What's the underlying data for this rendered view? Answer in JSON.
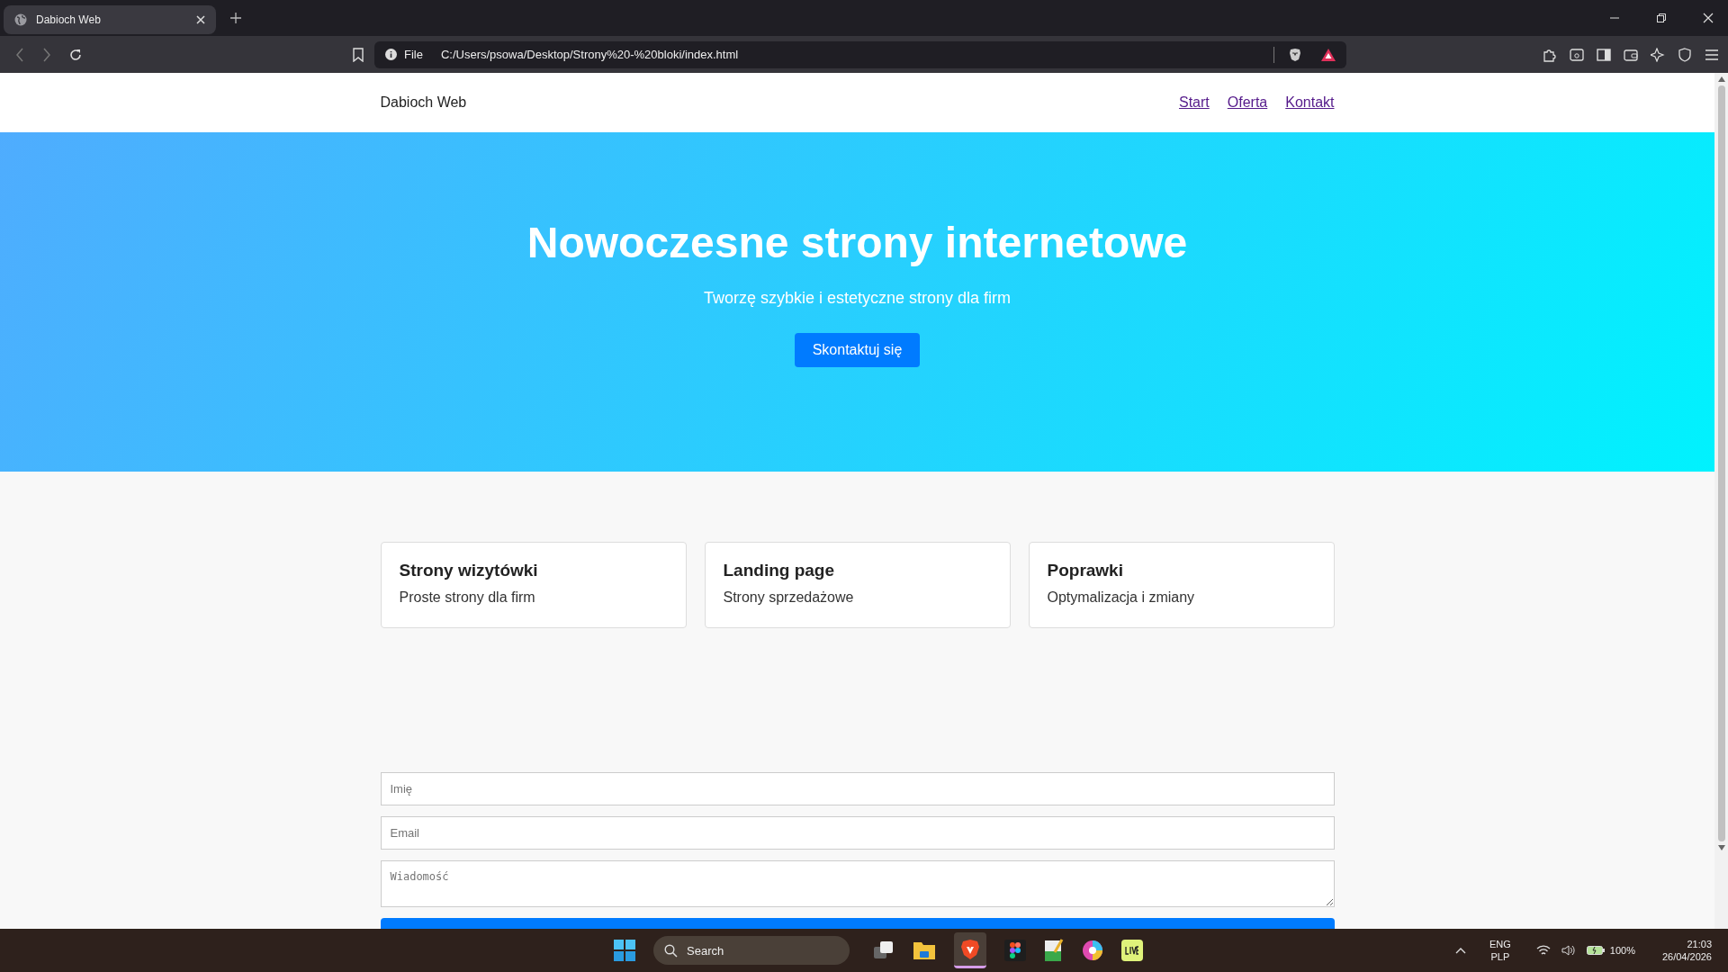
{
  "browser": {
    "tab": {
      "title": "Dabioch Web",
      "selected": true
    },
    "address": {
      "scheme": "File",
      "url": "C:/Users/psowa/Desktop/Strony%20-%20bloki/index.html"
    }
  },
  "site": {
    "logo": "Dabioch Web",
    "nav": [
      {
        "label": "Start"
      },
      {
        "label": "Oferta"
      },
      {
        "label": "Kontakt"
      }
    ],
    "hero": {
      "title": "Nowoczesne strony internetowe",
      "subtitle": "Tworzę szybkie i estetyczne strony dla firm",
      "button": "Skontaktuj się"
    },
    "cards": [
      {
        "title": "Strony wizytówki",
        "text": "Proste strony dla firm"
      },
      {
        "title": "Landing page",
        "text": "Strony sprzedażowe"
      },
      {
        "title": "Poprawki",
        "text": "Optymalizacja i zmiany"
      }
    ],
    "form": {
      "fields": [
        {
          "kind": "input",
          "placeholder": "Imię"
        },
        {
          "kind": "input",
          "placeholder": "Email"
        },
        {
          "kind": "textarea",
          "placeholder": "Wiadomość"
        }
      ]
    }
  },
  "taskbar": {
    "search": {
      "placeholder": "Search"
    },
    "tray": {
      "lang": "ENG",
      "layout": "PLP",
      "battery": "100%",
      "time": "21:03",
      "date": "26/04/2026"
    }
  }
}
